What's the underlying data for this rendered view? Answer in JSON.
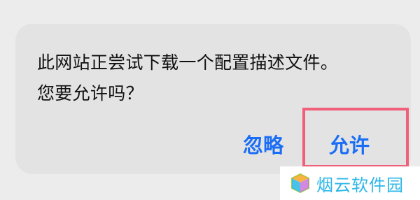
{
  "dialog": {
    "message_line1": "此网站正尝试下载一个配置描述文件。",
    "message_line2": "您要允许吗？",
    "deny_label": "忽略",
    "allow_label": "允许"
  },
  "watermark": {
    "text": "烟云软件园"
  },
  "colors": {
    "button_text": "#1a6ef5",
    "highlight_border": "#f0607a",
    "watermark_text": "#2cb6e8",
    "dialog_bg": "#e3e3e3"
  }
}
